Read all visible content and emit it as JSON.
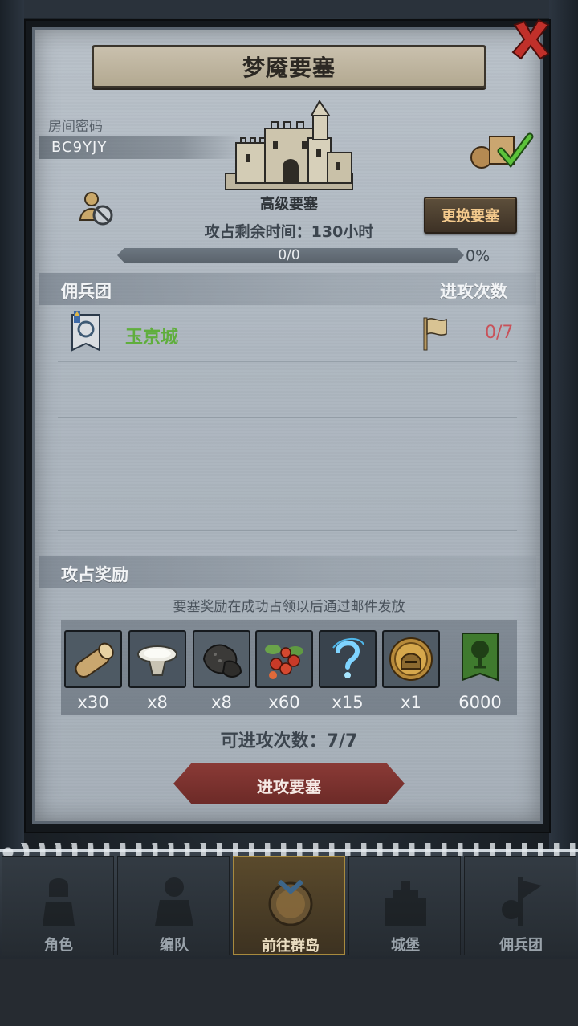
{
  "dialog": {
    "title": "梦魇要塞",
    "room_label": "房间密码",
    "room_code": "BC9YJY",
    "fortress_level": "高级要塞",
    "change_button": "更换要塞",
    "remaining_time": "攻占剩余时间：130小时",
    "progress_text": "0/0",
    "progress_percent": "0%",
    "progress_fraction": 0
  },
  "mercenary_section": {
    "title": "佣兵团",
    "attacks_header": "进攻次数",
    "rows": [
      {
        "name": "玉京城",
        "attacks": "0/7"
      }
    ]
  },
  "rewards_section": {
    "title": "攻占奖励",
    "note": "要塞奖励在成功占领以后通过邮件发放",
    "items": [
      {
        "icon": "wood-log-icon",
        "count": "x30"
      },
      {
        "icon": "flour-bowl-icon",
        "count": "x8"
      },
      {
        "icon": "ore-rock-icon",
        "count": "x8"
      },
      {
        "icon": "berries-icon",
        "count": "x60"
      },
      {
        "icon": "mystery-question-icon",
        "count": "x15"
      },
      {
        "icon": "knight-helmet-coin-icon",
        "count": "x1"
      },
      {
        "icon": "tree-banner-icon",
        "count": "6000"
      }
    ]
  },
  "attack_count": "可进攻次数：7/7",
  "attack_button": "进攻要塞",
  "bottom_nav": [
    {
      "label": "角色",
      "active": false
    },
    {
      "label": "编队",
      "active": false
    },
    {
      "label": "前往群岛",
      "active": true
    },
    {
      "label": "城堡",
      "active": false
    },
    {
      "label": "佣兵团",
      "active": false
    }
  ],
  "colors": {
    "guild_name": "#5fae3c",
    "attacks_red": "#c8525a",
    "button_gold": "#f3c98c",
    "attack_button": "#8a3a36"
  }
}
